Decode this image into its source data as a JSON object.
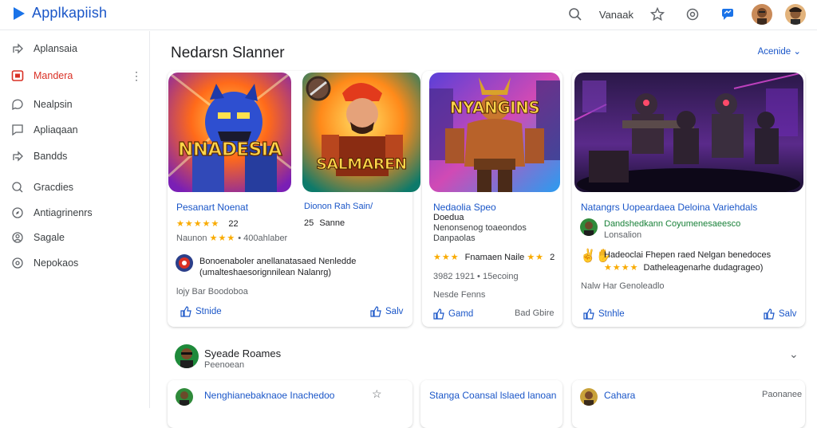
{
  "app": {
    "name": "Applkapiish"
  },
  "topbar": {
    "search_icon": "search-icon",
    "link": "Vanaak",
    "star_icon": "star-icon",
    "settings_icon": "gear-icon",
    "chat_icon": "chat-icon"
  },
  "sidebar": {
    "items": [
      {
        "label": "Aplansaia",
        "icon": "share-icon"
      },
      {
        "label": "Mandera",
        "icon": "play-box-icon",
        "active": true
      },
      {
        "label": "Nealpsin",
        "icon": "chat-icon"
      },
      {
        "label": "Apliaqaan",
        "icon": "message-icon"
      },
      {
        "label": "Bandds",
        "icon": "share-icon"
      },
      {
        "label": "Gracdies",
        "icon": "search-icon"
      },
      {
        "label": "Antiagrinenrs",
        "icon": "compass-icon"
      },
      {
        "label": "Sagale",
        "icon": "people-icon"
      },
      {
        "label": "Nepokaos",
        "icon": "settings-icon"
      }
    ]
  },
  "main": {
    "section_title": "Nedarsn Slanner",
    "section_more": "Acenide",
    "thumbs": [
      {
        "title_text": "NNADESIA"
      },
      {
        "title_text": "SALMAREN"
      },
      {
        "title_text": "NYANGINS"
      },
      {
        "title_text": ""
      }
    ],
    "cards": [
      {
        "title": "Pesanart Noenat",
        "title2": "Dionon Rah Sain/",
        "rating_value": "22",
        "rating_value2": "Sanne",
        "meta": "Naunon",
        "meta2": "• 400ahlaber",
        "desc": "Bonoenaboler anellanatasaed Nenledde",
        "desc2": "(umalteshaesorignnilean Nalanrg)",
        "footer": "lojy Bar Boodoboa",
        "action1": "Stnide",
        "action2": "Salv"
      },
      {
        "title": "Nedaolia Speo",
        "sub1": "Doedua",
        "sub2": "Nenonsenog toaeondos",
        "sub3": "Danpaolas",
        "stats": "Fnamaen Naile",
        "stats_num": "2",
        "year": "3982 1921 • 15ecoing",
        "footer": "Nesde Fenns",
        "action1": "Gamd",
        "action2": "Bad Gbire"
      },
      {
        "title": "Natangrs Uopeardaea Deloina Variehdals",
        "line1": "Dandshedkann Coyumenesaeesco",
        "line2": "Lonsalion",
        "desc": "Hadeoclai Fhepen raed Nelgan benedoces",
        "desc2": "Datheleagenarhe dudagrageo)",
        "footer": "Nalw Har Genoleadlo",
        "action1": "Stnhle",
        "action2": "Salv"
      }
    ],
    "section2_title": "Syeade Roames",
    "section2_sub": "Peenoean",
    "bottom_cards": [
      {
        "title": "Nenghianebaknaoe Inachedoo"
      },
      {
        "title": "Stanga Coansal lslaed lanoan"
      },
      {
        "title": "Cahara",
        "meta": "Paonanee"
      }
    ]
  },
  "colors": {
    "accent": "#1a56c8",
    "active": "#d93025",
    "star": "#f9ab00"
  }
}
